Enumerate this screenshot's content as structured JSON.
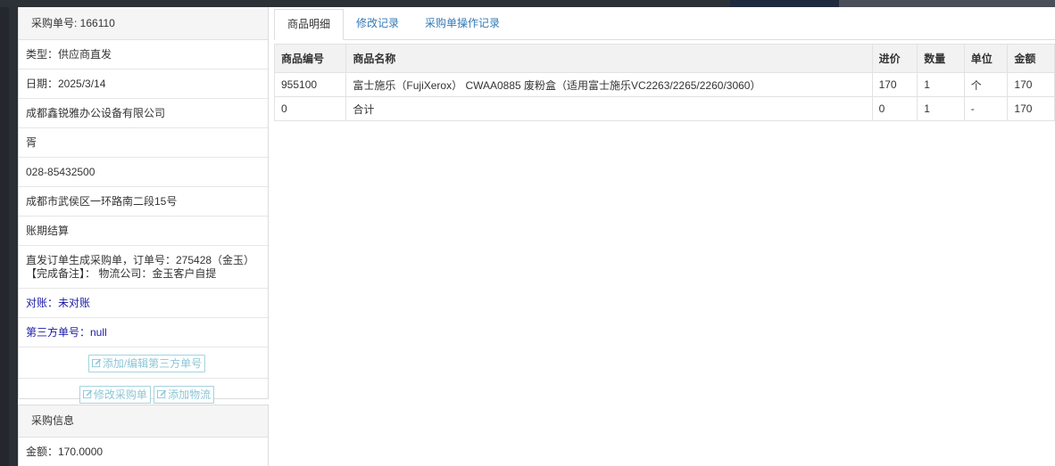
{
  "order_panel": {
    "header": "采购单号: 166110",
    "type": "类型：供应商直发",
    "date": "日期：2025/3/14",
    "company": "成都鑫锐雅办公设备有限公司",
    "contact": "胥",
    "phone": "028-85432500",
    "address": "成都市武侯区一环路南二段15号",
    "payment": "账期结算",
    "note_line1": "直发订单生成采购单，订单号：275428（金玉）",
    "note_line2": "【完成备注】： 物流公司：金玉客户自提",
    "reconcile": "对账：未对账",
    "third_party": "第三方单号：null",
    "btn_third_party": "添加/编辑第三方单号",
    "btn_edit_order": "修改采购单",
    "btn_add_logistics": "添加物流"
  },
  "info_panel": {
    "header": "采购信息",
    "amount": "金额：170.0000"
  },
  "tabs": [
    {
      "label": "商品明细"
    },
    {
      "label": "修改记录"
    },
    {
      "label": "采购单操作记录"
    }
  ],
  "table": {
    "columns": [
      "商品编号",
      "商品名称",
      "进价",
      "数量",
      "单位",
      "金额"
    ],
    "rows": [
      [
        "955100",
        "富士施乐（FujiXerox） CWAA0885 废粉盒（适用富士施乐VC2263/2265/2260/3060）",
        "170",
        "1",
        "个",
        "170"
      ],
      [
        "0",
        "合计",
        "0",
        "1",
        "-",
        "170"
      ]
    ]
  },
  "colors": {
    "tab_link": "#337ab7",
    "button_border": "#a6d3df",
    "button_text": "#8dc6d6",
    "reconcile_text": "#1a1aa6",
    "top_bar": "#2c3037"
  },
  "icons": {
    "edit_button_icon": "pencil-square-icon"
  }
}
